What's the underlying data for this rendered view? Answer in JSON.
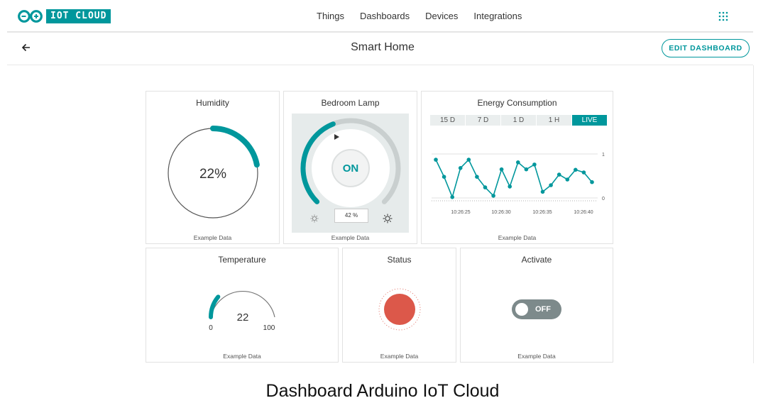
{
  "app": {
    "logo_text": "IOT CLOUD"
  },
  "nav": {
    "items": [
      "Things",
      "Dashboards",
      "Devices",
      "Integrations"
    ]
  },
  "header": {
    "title": "Smart Home",
    "edit_label": "EDIT DASHBOARD"
  },
  "widgets": {
    "humidity": {
      "title": "Humidity",
      "value": "22%",
      "percent": 22,
      "footer": "Example Data"
    },
    "lamp": {
      "title": "Bedroom Lamp",
      "state": "ON",
      "brightness": "42 %",
      "brightness_value": 42,
      "footer": "Example Data"
    },
    "energy": {
      "title": "Energy Consumption",
      "tabs": [
        "15 D",
        "7 D",
        "1 D",
        "1 H",
        "LIVE"
      ],
      "active_tab": "LIVE",
      "footer": "Example Data"
    },
    "temperature": {
      "title": "Temperature",
      "value": "22",
      "min": "0",
      "max": "100",
      "value_num": 22,
      "footer": "Example Data"
    },
    "status": {
      "title": "Status",
      "color": "#dc584a",
      "footer": "Example Data"
    },
    "activate": {
      "title": "Activate",
      "state": "OFF",
      "footer": "Example Data"
    }
  },
  "chart_data": {
    "type": "line",
    "title": "",
    "y_ticks": [
      "1",
      "0"
    ],
    "ylim": [
      0,
      1
    ],
    "x_ticks": [
      "10:26:25",
      "10:26:30",
      "10:26:35",
      "10:26:40"
    ],
    "values": [
      0.87,
      0.48,
      0.02,
      0.68,
      0.87,
      0.48,
      0.24,
      0.05,
      0.65,
      0.26,
      0.81,
      0.65,
      0.76,
      0.14,
      0.29,
      0.53,
      0.42,
      0.64,
      0.58,
      0.36
    ],
    "color": "#00979c",
    "grid": true
  },
  "caption": "Dashboard Arduino IoT Cloud"
}
